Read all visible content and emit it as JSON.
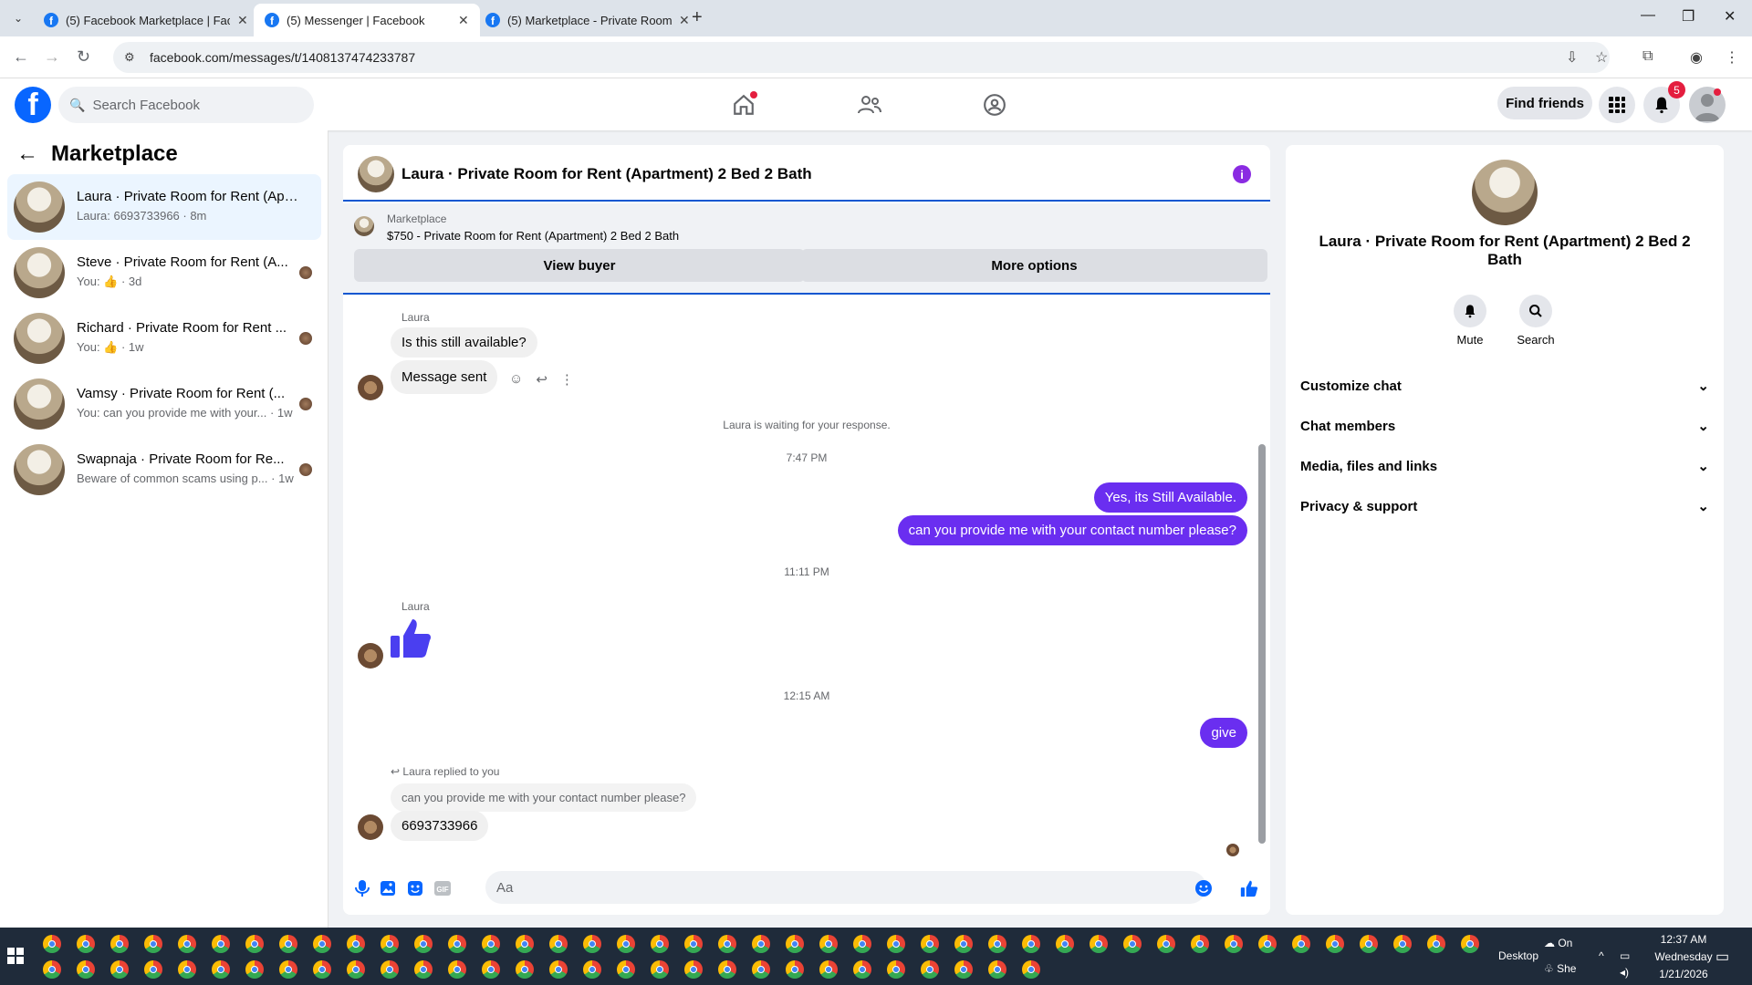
{
  "browser": {
    "tabs": [
      {
        "label": "(5) Facebook Marketplace | Fac"
      },
      {
        "label": "(5) Messenger | Facebook"
      },
      {
        "label": "(5) Marketplace - Private Room"
      }
    ],
    "url": "facebook.com/messages/t/1408137474233787"
  },
  "fb": {
    "search_placeholder": "Search Facebook",
    "find_friends": "Find friends",
    "notif_count": "5"
  },
  "left": {
    "title": "Marketplace",
    "conversations": [
      {
        "name": "Laura · Private Room for Rent (Apa...",
        "sub": "Laura: 6693733966 · 8m"
      },
      {
        "name": "Steve · Private Room for Rent (A...",
        "sub": "You: 👍 · 3d"
      },
      {
        "name": "Richard · Private Room for Rent ...",
        "sub": "You: 👍 · 1w"
      },
      {
        "name": "Vamsy · Private Room for Rent (...",
        "sub": "You: can you provide me with your... · 1w"
      },
      {
        "name": "Swapnaja · Private Room for Re...",
        "sub": "Beware of common scams using p... · 1w"
      }
    ]
  },
  "chat": {
    "title": "Laura · Private Room for Rent (Apartment) 2 Bed 2 Bath",
    "listing_label": "Marketplace",
    "listing_text": "$750 - Private Room for Rent (Apartment) 2 Bed 2 Bath",
    "view_buyer": "View buyer",
    "more_options": "More options",
    "msg_sender1": "Laura",
    "msg1": "Is this still available?",
    "msg2": "Message sent",
    "waiting": "Laura is waiting for your response.",
    "time1": "7:47 PM",
    "out1": "Yes, its Still Available.",
    "out2": "can you provide me with your contact number please?",
    "time2": "11:11 PM",
    "msg_sender2": "Laura",
    "time3": "12:15 AM",
    "out3": "give",
    "reply_label": "Laura replied to you",
    "reply_quote": "can you provide me with your contact number please?",
    "msg3": "6693733966",
    "composer_placeholder": "Aa"
  },
  "right": {
    "title": "Laura · Private Room for Rent (Apartment) 2 Bed 2 Bath",
    "mute": "Mute",
    "search": "Search",
    "rows": [
      "Customize chat",
      "Chat members",
      "Media, files and links",
      "Privacy & support"
    ]
  },
  "taskbar": {
    "desktop": "Desktop",
    "onedrive": "On",
    "she": "She",
    "time": "12:37 AM",
    "day": "Wednesday",
    "date": "1/21/2026"
  },
  "colors": {
    "accent": "#6a2ef0",
    "fb_blue": "#0866ff",
    "badge_red": "#e41e3f"
  }
}
